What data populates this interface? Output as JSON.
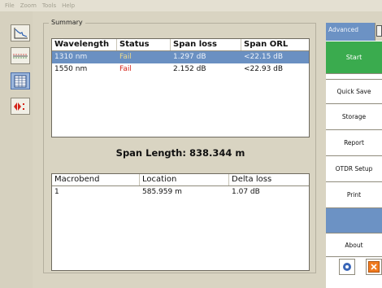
{
  "menu": [
    "File",
    "Zoom",
    "Tools",
    "Help"
  ],
  "left_tools": [
    {
      "icon": "trace-graph-icon"
    },
    {
      "icon": "event-map-icon"
    },
    {
      "icon": "summary-table-icon",
      "active": true
    },
    {
      "icon": "fiber-marker-icon"
    }
  ],
  "summary": {
    "label": "Summary",
    "results_table": {
      "columns": [
        "Wavelength",
        "Status",
        "Span loss",
        "Span ORL"
      ],
      "rows": [
        {
          "wavelength": "1310 nm",
          "status": "Fail",
          "span_loss": "1.297 dB",
          "span_orl": "<22.15 dB",
          "selected": true
        },
        {
          "wavelength": "1550 nm",
          "status": "Fail",
          "span_loss": "2.152 dB",
          "span_orl": "<22.93 dB",
          "selected": false
        }
      ]
    },
    "span_length": "Span Length: 838.344 m",
    "macrobend_table": {
      "columns": [
        "Macrobend",
        "Location",
        "Delta loss"
      ],
      "rows": [
        {
          "macrobend": "1",
          "location": "585.959 m",
          "delta_loss": "1.07 dB"
        }
      ]
    }
  },
  "right_panel": {
    "tab_label": "Advanced",
    "buttons": {
      "start": "Start",
      "quick_save": "Quick Save",
      "storage": "Storage",
      "report": "Report",
      "otdr_setup": "OTDR Setup",
      "print": "Print",
      "about": "About"
    },
    "icons": [
      "help-icon",
      "exit-icon"
    ]
  },
  "colors": {
    "selection": "#6a90c2",
    "fail": "#d42419",
    "start": "#3aab4e",
    "panel": "#d9d4c2"
  }
}
